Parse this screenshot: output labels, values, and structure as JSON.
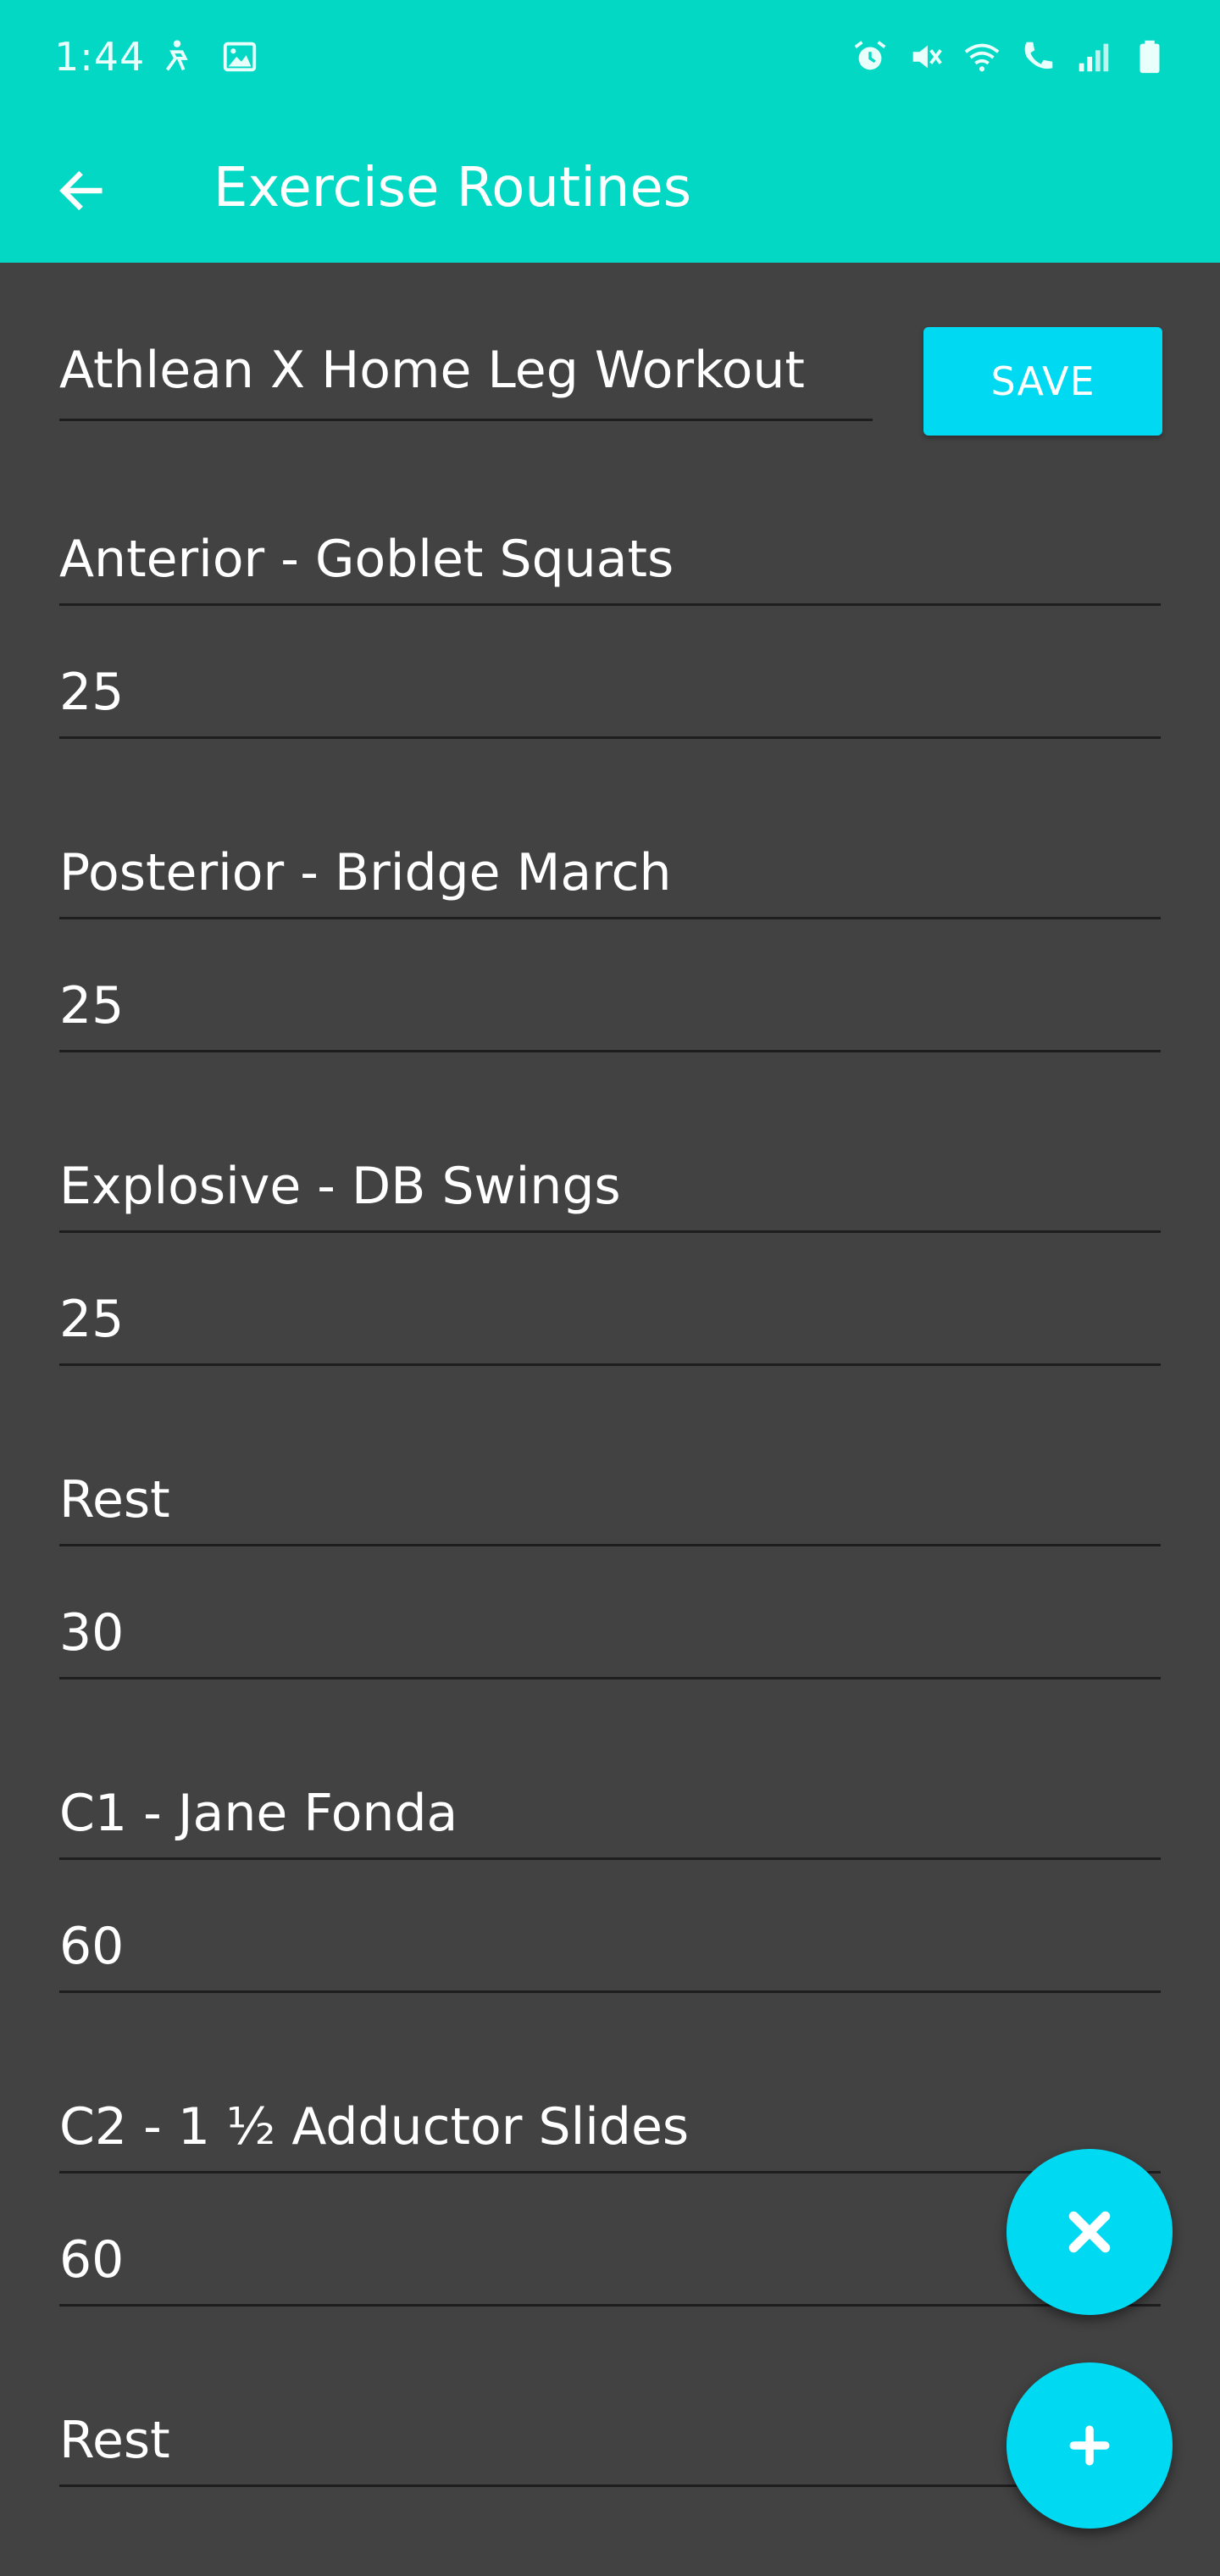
{
  "status_bar": {
    "time": "1:44",
    "left_icons": [
      "accessibility-icon",
      "image-icon"
    ],
    "right_icons": [
      "alarm-icon",
      "mute-icon",
      "wifi-icon",
      "wifi-calling-icon",
      "signal-icon",
      "battery-icon"
    ]
  },
  "app_bar": {
    "title": "Exercise Routines",
    "back_icon": "arrow-left-icon"
  },
  "routine": {
    "name": "Athlean X Home Leg Workout",
    "save_label": "SAVE"
  },
  "exercises": [
    {
      "name": "Anterior - Goblet Squats",
      "duration": "25"
    },
    {
      "name": "Posterior - Bridge March",
      "duration": "25"
    },
    {
      "name": "Explosive - DB Swings",
      "duration": "25"
    },
    {
      "name": "Rest",
      "duration": "30"
    },
    {
      "name": "C1 - Jane Fonda",
      "duration": "60"
    },
    {
      "name": "C2 - 1 ½ Adductor Slides",
      "duration": "60"
    },
    {
      "name": "Rest",
      "duration": ""
    }
  ],
  "fabs": {
    "close_icon": "close-icon",
    "add_icon": "plus-icon"
  },
  "colors": {
    "primary": "#03d8c4",
    "accent": "#00d9f2",
    "background": "#424242"
  }
}
